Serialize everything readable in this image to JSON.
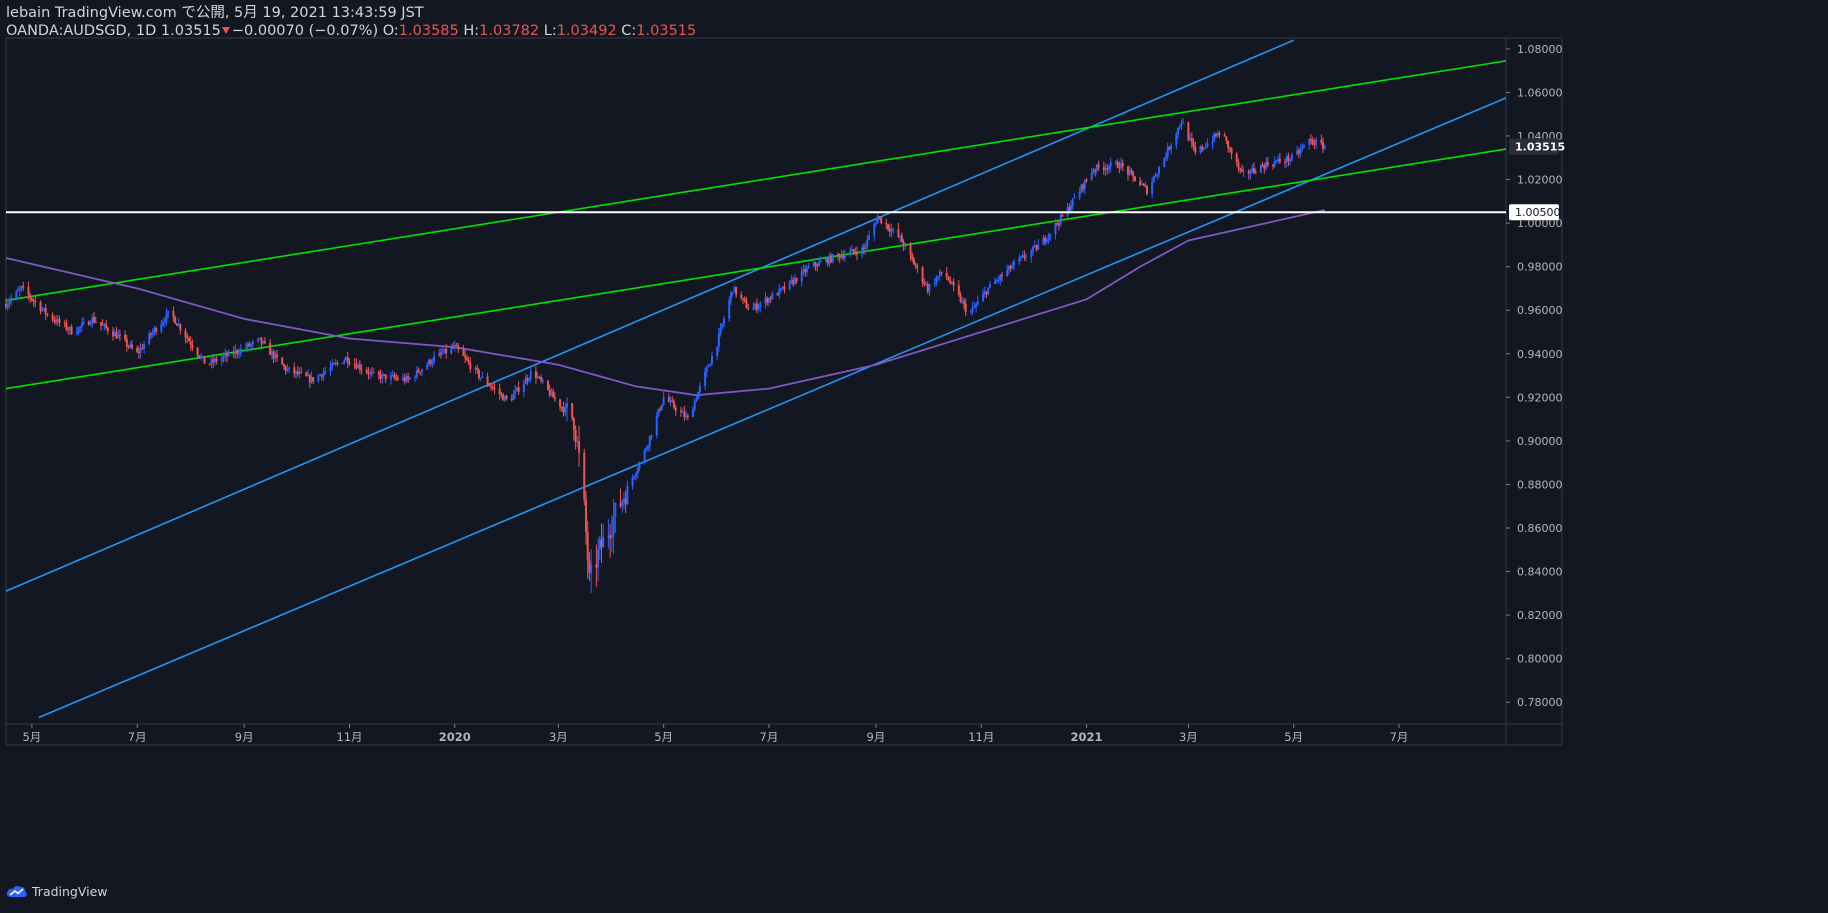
{
  "header": {
    "published_line": "lebain TradingView.com で公開, 5月 19, 2021 13:43:59 JST",
    "symbol": "OANDA:AUDSGD, 1D",
    "last": "1.03515",
    "change": "−0.00070 (−0.07%)",
    "o_label": "O:",
    "o_value": "1.03585",
    "h_label": "H:",
    "h_value": "1.03782",
    "l_label": "L:",
    "l_value": "1.03492",
    "c_label": "C:",
    "c_value": "1.03515"
  },
  "footer": {
    "brand": "TradingView",
    "logo_icon": "tradingview-cloud-icon"
  },
  "chart_data": {
    "type": "candlestick",
    "title": "",
    "xlabel": "",
    "ylabel": "",
    "ylim": [
      0.77,
      1.085
    ],
    "x_range": [
      "2019-04-16",
      "2021-09-01"
    ],
    "grid": false,
    "y_ticks": [
      "0.78000",
      "0.80000",
      "0.82000",
      "0.84000",
      "0.86000",
      "0.88000",
      "0.90000",
      "0.92000",
      "0.94000",
      "0.96000",
      "0.98000",
      "1.00000",
      "1.02000",
      "1.04000",
      "1.06000",
      "1.08000"
    ],
    "x_ticks": [
      {
        "label": "5月",
        "date": "2019-05-01"
      },
      {
        "label": "7月",
        "date": "2019-07-01"
      },
      {
        "label": "9月",
        "date": "2019-09-01"
      },
      {
        "label": "11月",
        "date": "2019-11-01"
      },
      {
        "label": "2020",
        "date": "2020-01-01",
        "bold": true
      },
      {
        "label": "3月",
        "date": "2020-03-01"
      },
      {
        "label": "5月",
        "date": "2020-05-01"
      },
      {
        "label": "7月",
        "date": "2020-07-01"
      },
      {
        "label": "9月",
        "date": "2020-09-01"
      },
      {
        "label": "11月",
        "date": "2020-11-01"
      },
      {
        "label": "2021",
        "date": "2021-01-01",
        "bold": true
      },
      {
        "label": "3月",
        "date": "2021-03-01"
      },
      {
        "label": "5月",
        "date": "2021-05-01"
      },
      {
        "label": "7月",
        "date": "2021-07-01"
      }
    ],
    "price_path": [
      {
        "date": "2019-04-16",
        "close": 0.963
      },
      {
        "date": "2019-04-25",
        "close": 0.97
      },
      {
        "date": "2019-05-10",
        "close": 0.958
      },
      {
        "date": "2019-05-25",
        "close": 0.95
      },
      {
        "date": "2019-06-05",
        "close": 0.956
      },
      {
        "date": "2019-06-20",
        "close": 0.948
      },
      {
        "date": "2019-07-01",
        "close": 0.94
      },
      {
        "date": "2019-07-10",
        "close": 0.95
      },
      {
        "date": "2019-07-20",
        "close": 0.959
      },
      {
        "date": "2019-08-01",
        "close": 0.945
      },
      {
        "date": "2019-08-10",
        "close": 0.935
      },
      {
        "date": "2019-08-25",
        "close": 0.94
      },
      {
        "date": "2019-09-10",
        "close": 0.946
      },
      {
        "date": "2019-09-25",
        "close": 0.933
      },
      {
        "date": "2019-10-10",
        "close": 0.928
      },
      {
        "date": "2019-10-30",
        "close": 0.938
      },
      {
        "date": "2019-11-15",
        "close": 0.93
      },
      {
        "date": "2019-12-05",
        "close": 0.928
      },
      {
        "date": "2019-12-20",
        "close": 0.938
      },
      {
        "date": "2020-01-01",
        "close": 0.943
      },
      {
        "date": "2020-01-15",
        "close": 0.93
      },
      {
        "date": "2020-02-01",
        "close": 0.918
      },
      {
        "date": "2020-02-15",
        "close": 0.932
      },
      {
        "date": "2020-02-28",
        "close": 0.919
      },
      {
        "date": "2020-03-10",
        "close": 0.91
      },
      {
        "date": "2020-03-15",
        "close": 0.88
      },
      {
        "date": "2020-03-19",
        "close": 0.835
      },
      {
        "date": "2020-03-25",
        "close": 0.85
      },
      {
        "date": "2020-04-05",
        "close": 0.87
      },
      {
        "date": "2020-04-20",
        "close": 0.895
      },
      {
        "date": "2020-05-01",
        "close": 0.92
      },
      {
        "date": "2020-05-15",
        "close": 0.91
      },
      {
        "date": "2020-06-01",
        "close": 0.945
      },
      {
        "date": "2020-06-10",
        "close": 0.97
      },
      {
        "date": "2020-06-20",
        "close": 0.96
      },
      {
        "date": "2020-07-10",
        "close": 0.97
      },
      {
        "date": "2020-07-25",
        "close": 0.98
      },
      {
        "date": "2020-08-10",
        "close": 0.985
      },
      {
        "date": "2020-08-25",
        "close": 0.988
      },
      {
        "date": "2020-09-02",
        "close": 1.003
      },
      {
        "date": "2020-09-15",
        "close": 0.993
      },
      {
        "date": "2020-10-01",
        "close": 0.97
      },
      {
        "date": "2020-10-10",
        "close": 0.978
      },
      {
        "date": "2020-10-25",
        "close": 0.958
      },
      {
        "date": "2020-11-05",
        "close": 0.97
      },
      {
        "date": "2020-11-20",
        "close": 0.981
      },
      {
        "date": "2020-12-05",
        "close": 0.99
      },
      {
        "date": "2020-12-20",
        "close": 1.005
      },
      {
        "date": "2021-01-05",
        "close": 1.025
      },
      {
        "date": "2021-01-20",
        "close": 1.027
      },
      {
        "date": "2021-02-05",
        "close": 1.015
      },
      {
        "date": "2021-02-15",
        "close": 1.03
      },
      {
        "date": "2021-02-25",
        "close": 1.047
      },
      {
        "date": "2021-03-05",
        "close": 1.032
      },
      {
        "date": "2021-03-20",
        "close": 1.042
      },
      {
        "date": "2021-04-01",
        "close": 1.022
      },
      {
        "date": "2021-04-15",
        "close": 1.027
      },
      {
        "date": "2021-05-01",
        "close": 1.03
      },
      {
        "date": "2021-05-10",
        "close": 1.038
      },
      {
        "date": "2021-05-19",
        "close": 1.03515
      }
    ],
    "candle_colors": {
      "up": "#2962ff",
      "down": "#ef5350"
    },
    "series": [
      {
        "type": "line",
        "color": "#7e57c2",
        "points": [
          {
            "date": "2019-04-16",
            "value": 0.984
          },
          {
            "date": "2019-07-01",
            "value": 0.97
          },
          {
            "date": "2019-09-01",
            "value": 0.956
          },
          {
            "date": "2019-11-01",
            "value": 0.947
          },
          {
            "date": "2020-01-01",
            "value": 0.943
          },
          {
            "date": "2020-03-01",
            "value": 0.935
          },
          {
            "date": "2020-04-15",
            "value": 0.925
          },
          {
            "date": "2020-05-20",
            "value": 0.921
          },
          {
            "date": "2020-07-01",
            "value": 0.924
          },
          {
            "date": "2020-09-01",
            "value": 0.935
          },
          {
            "date": "2020-11-01",
            "value": 0.95
          },
          {
            "date": "2021-01-01",
            "value": 0.965
          },
          {
            "date": "2021-02-01",
            "value": 0.98
          },
          {
            "date": "2021-03-01",
            "value": 0.992
          },
          {
            "date": "2021-05-19",
            "value": 1.006
          }
        ]
      }
    ],
    "trendlines": [
      {
        "color": "#2196f3",
        "from": {
          "date": "2019-04-16",
          "value": 0.831
        },
        "to": {
          "date": "2021-05-01",
          "value": 1.084
        }
      },
      {
        "color": "#2196f3",
        "from": {
          "date": "2019-05-05",
          "value": 0.773
        },
        "to": {
          "date": "2021-09-01",
          "value": 1.0575
        }
      },
      {
        "color": "#00e400",
        "from": {
          "date": "2019-04-16",
          "value": 0.9645
        },
        "to": {
          "date": "2021-09-01",
          "value": 1.0745
        }
      },
      {
        "color": "#00e400",
        "from": {
          "date": "2019-04-16",
          "value": 0.924
        },
        "to": {
          "date": "2021-09-01",
          "value": 1.034
        }
      }
    ],
    "hline": {
      "value": 1.005,
      "label": "1.00500",
      "color": "#ffffff"
    },
    "current_price": {
      "value": 1.03515,
      "label": "1.03515"
    }
  }
}
